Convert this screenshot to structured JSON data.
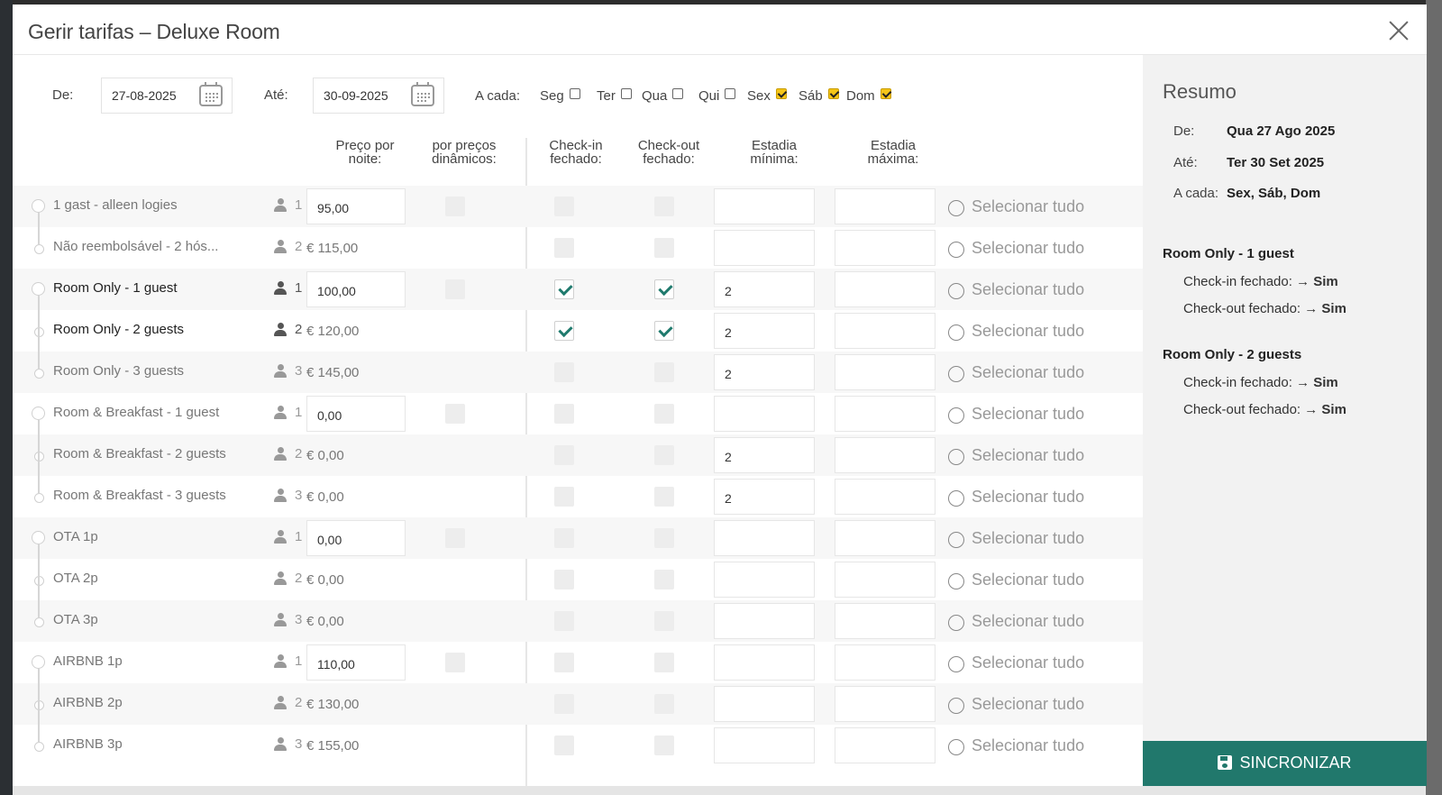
{
  "modal": {
    "title": "Gerir tarifas  –  Deluxe Room"
  },
  "filter": {
    "from_label": "De:",
    "from_value": "27-08-2025",
    "to_label": "Até:",
    "to_value": "30-09-2025",
    "every_label": "A cada:",
    "days": [
      {
        "label": "Seg",
        "checked": false
      },
      {
        "label": "Ter",
        "checked": false
      },
      {
        "label": "Qua",
        "checked": false
      },
      {
        "label": "Qui",
        "checked": false
      },
      {
        "label": "Sex",
        "checked": true
      },
      {
        "label": "Sáb",
        "checked": true
      },
      {
        "label": "Dom",
        "checked": true
      }
    ]
  },
  "columns": {
    "price": [
      "Preço por",
      "noite:"
    ],
    "dynamic": [
      "por preços",
      "dinâmicos:"
    ],
    "checkin": [
      "Check-in",
      "fechado:"
    ],
    "checkout": [
      "Check-out",
      "fechado:"
    ],
    "min_stay": [
      "Estadia",
      "mínima:"
    ],
    "max_stay": [
      "Estadia",
      "máxima:"
    ]
  },
  "select_all_label": "Selecionar tudo",
  "rows": [
    {
      "name": "1 gast - alleen logies",
      "guests": "1",
      "price": "95,00",
      "base": true,
      "active": false,
      "checkin": false,
      "checkout": false,
      "min": ""
    },
    {
      "name": "Não reembolsável - 2 hós...",
      "guests": "2",
      "price": "€ 115,00",
      "base": false,
      "active": false,
      "checkin": false,
      "checkout": false,
      "min": ""
    },
    {
      "name": "Room Only - 1 guest",
      "guests": "1",
      "price": "100,00",
      "base": true,
      "active": true,
      "checkin": true,
      "checkout": true,
      "min": "2"
    },
    {
      "name": "Room Only - 2 guests",
      "guests": "2",
      "price": "€ 120,00",
      "base": false,
      "active": true,
      "checkin": true,
      "checkout": true,
      "min": "2"
    },
    {
      "name": "Room Only - 3 guests",
      "guests": "3",
      "price": "€ 145,00",
      "base": false,
      "active": false,
      "checkin": false,
      "checkout": false,
      "min": "2"
    },
    {
      "name": "Room & Breakfast - 1 guest",
      "guests": "1",
      "price": "0,00",
      "base": true,
      "active": false,
      "checkin": false,
      "checkout": false,
      "min": ""
    },
    {
      "name": "Room & Breakfast - 2 guests",
      "guests": "2",
      "price": "€ 0,00",
      "base": false,
      "active": false,
      "checkin": false,
      "checkout": false,
      "min": "2"
    },
    {
      "name": "Room & Breakfast - 3 guests",
      "guests": "3",
      "price": "€ 0,00",
      "base": false,
      "active": false,
      "checkin": false,
      "checkout": false,
      "min": "2"
    },
    {
      "name": "OTA 1p",
      "guests": "1",
      "price": "0,00",
      "base": true,
      "active": false,
      "checkin": false,
      "checkout": false,
      "min": ""
    },
    {
      "name": "OTA 2p",
      "guests": "2",
      "price": "€ 0,00",
      "base": false,
      "active": false,
      "checkin": false,
      "checkout": false,
      "min": ""
    },
    {
      "name": "OTA 3p",
      "guests": "3",
      "price": "€ 0,00",
      "base": false,
      "active": false,
      "checkin": false,
      "checkout": false,
      "min": ""
    },
    {
      "name": "AIRBNB 1p",
      "guests": "1",
      "price": "110,00",
      "base": true,
      "active": false,
      "checkin": false,
      "checkout": false,
      "min": ""
    },
    {
      "name": "AIRBNB 2p",
      "guests": "2",
      "price": "€ 130,00",
      "base": false,
      "active": false,
      "checkin": false,
      "checkout": false,
      "min": ""
    },
    {
      "name": "AIRBNB 3p",
      "guests": "3",
      "price": "€ 155,00",
      "base": false,
      "active": false,
      "checkin": false,
      "checkout": false,
      "min": ""
    }
  ],
  "summary": {
    "title": "Resumo",
    "from_label": "De:",
    "from_value": "Qua 27 Ago 2025",
    "to_label": "Até:",
    "to_value": "Ter 30 Set 2025",
    "every_label": "A cada:",
    "every_value": "Sex, Sáb, Dom",
    "groups": [
      {
        "title": "Room Only - 1 guest",
        "lines": [
          {
            "label": "Check-in fechado:",
            "value": "Sim"
          },
          {
            "label": "Check-out fechado:",
            "value": "Sim"
          }
        ]
      },
      {
        "title": "Room Only - 2 guests",
        "lines": [
          {
            "label": "Check-in fechado:",
            "value": "Sim"
          },
          {
            "label": "Check-out fechado:",
            "value": "Sim"
          }
        ]
      }
    ],
    "sync_label": "SINCRONIZAR"
  },
  "colors": {
    "accent": "#21786c",
    "day_checked": "#f5c518"
  }
}
